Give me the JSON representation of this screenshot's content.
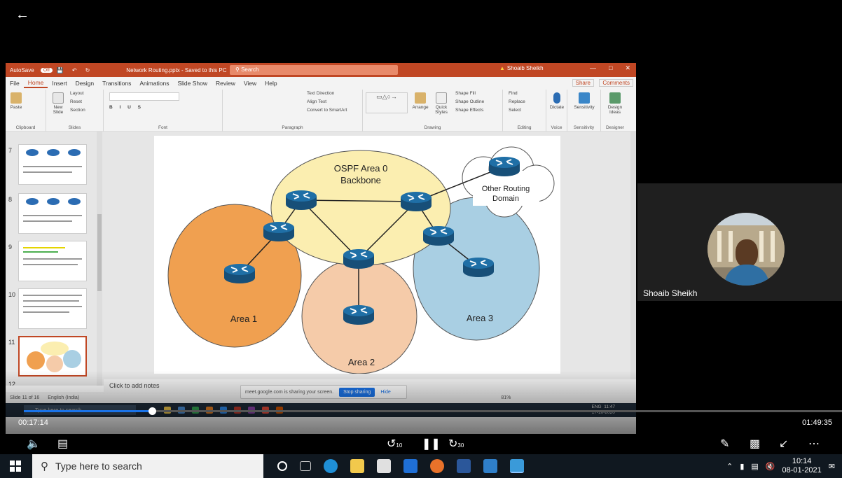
{
  "meet": {
    "back_icon": "arrow-left-icon",
    "participant_name": "Shoaib Sheikh"
  },
  "ppt": {
    "autosave_label": "AutoSave",
    "autosave_state": "Off",
    "file_title": "Network Routing.pptx - Saved to this PC",
    "search_placeholder": "Search",
    "user_name": "Shoaib Sheikh",
    "menu": [
      "File",
      "Home",
      "Insert",
      "Design",
      "Transitions",
      "Animations",
      "Slide Show",
      "Review",
      "View",
      "Help"
    ],
    "share_label": "Share",
    "comments_label": "Comments",
    "ribbon": {
      "clipboard": "Clipboard",
      "paste": "Paste",
      "new_slide": "New Slide",
      "layout": "Layout",
      "reset": "Reset",
      "section": "Section",
      "slides": "Slides",
      "font": "Font",
      "paragraph": "Paragraph",
      "text_direction": "Text Direction",
      "align_text": "Align Text",
      "convert_smartart": "Convert to SmartArt",
      "arrange": "Arrange",
      "quick_styles": "Quick Styles",
      "shape_fill": "Shape Fill",
      "shape_outline": "Shape Outline",
      "shape_effects": "Shape Effects",
      "drawing": "Drawing",
      "find": "Find",
      "replace": "Replace",
      "select": "Select",
      "editing": "Editing",
      "dictate": "Dictate",
      "voice": "Voice",
      "sensitivity": "Sensitivity",
      "design_ideas": "Design Ideas",
      "designer": "Designer"
    },
    "thumb_numbers": [
      "7",
      "8",
      "9",
      "10",
      "11",
      "12"
    ],
    "notes_placeholder": "Click to add notes",
    "status": {
      "slide_info": "Slide 11 of 16",
      "language": "English (India)",
      "notes": "Notes",
      "zoom": "81%"
    },
    "share_banner": {
      "text": "meet.google.com is sharing your screen.",
      "stop": "Stop sharing",
      "hide": "Hide"
    },
    "inner_taskbar": {
      "search": "Type here to search",
      "lang": "ENG",
      "time": "11:47",
      "date": "17-10-2020"
    }
  },
  "diagram": {
    "backbone_title": "OSPF Area 0",
    "backbone_sub": "Backbone",
    "other_domain": "Other Routing Domain",
    "area1": "Area 1",
    "area2": "Area 2",
    "area3": "Area 3",
    "colors": {
      "backbone": "#fbeeb0",
      "area1": "#f0a050",
      "area2": "#f5cba9",
      "area3": "#a9cfe3",
      "router": "#1f6fa6"
    }
  },
  "player": {
    "elapsed": "00:17:14",
    "duration": "01:49:35",
    "progress": 0.157,
    "rewind_label": "10",
    "forward_label": "30"
  },
  "taskbar": {
    "search_placeholder": "Type here to search",
    "time": "10:14",
    "date": "08-01-2021"
  }
}
